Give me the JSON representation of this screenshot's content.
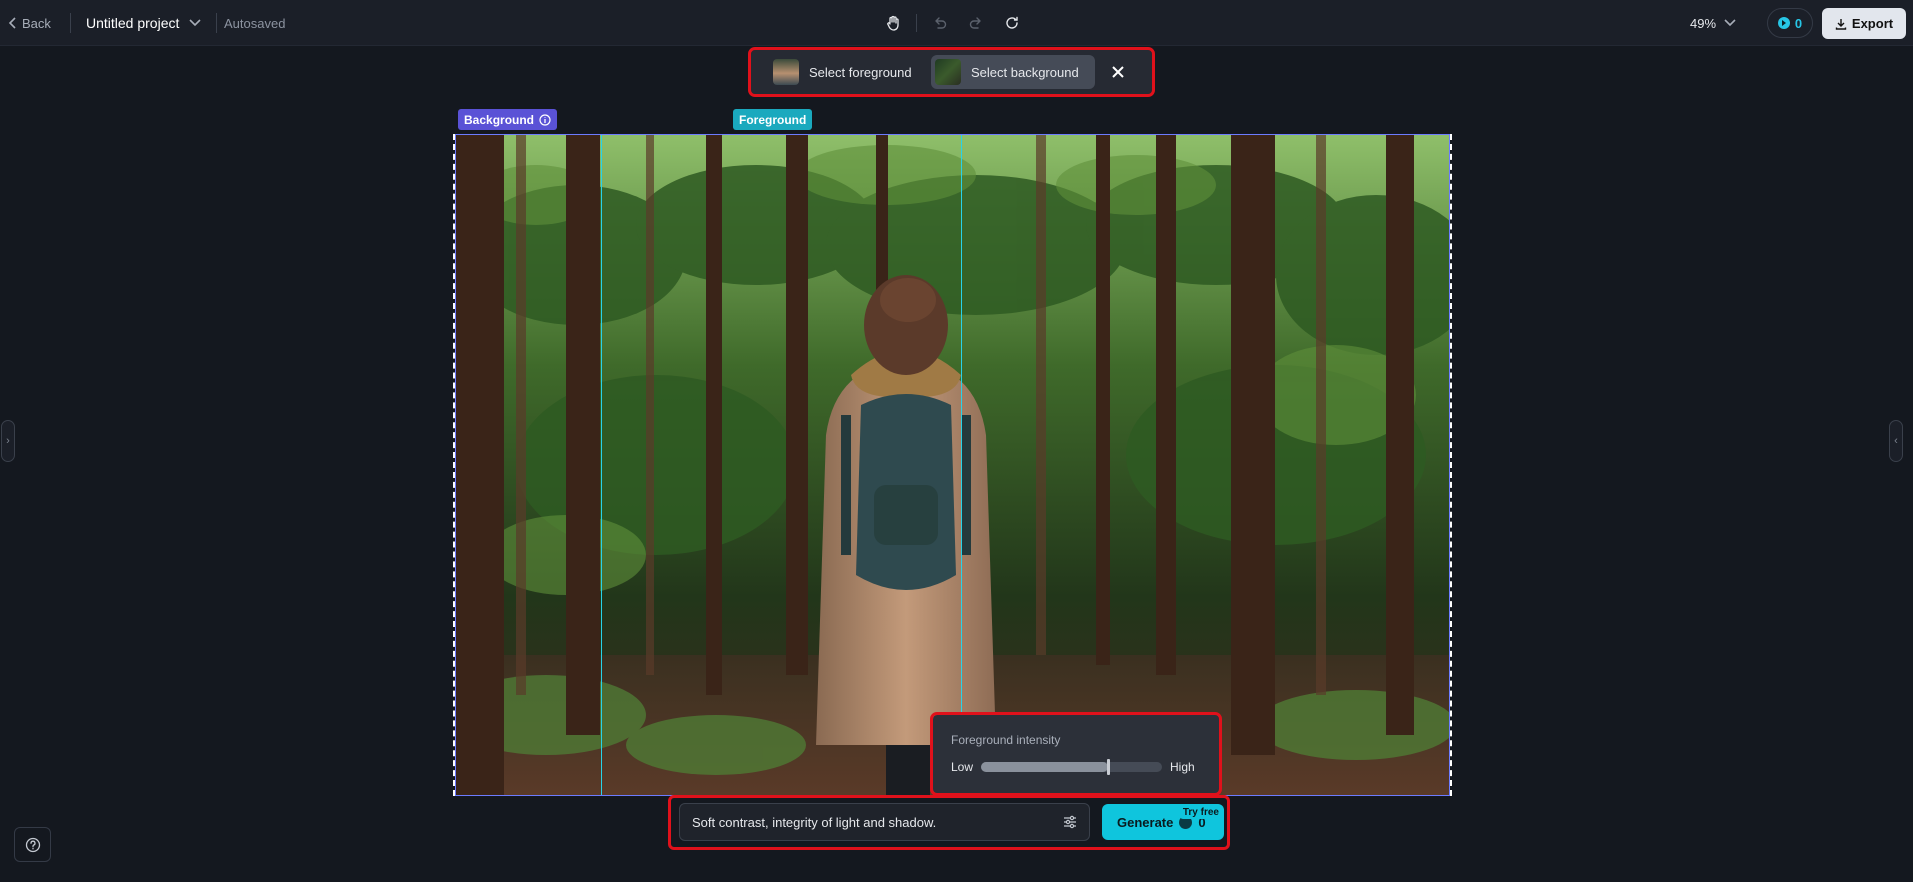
{
  "header": {
    "back_label": "Back",
    "project_name": "Untitled project",
    "autosave_status": "Autosaved",
    "zoom_level": "49%",
    "credits": "0",
    "export_label": "Export"
  },
  "tools": {
    "icons": [
      "hand-icon",
      "undo-icon",
      "redo-icon",
      "refresh-icon"
    ]
  },
  "select_bar": {
    "foreground_label": "Select foreground",
    "background_label": "Select background",
    "active": "background"
  },
  "canvas": {
    "background_tag": "Background",
    "foreground_tag": "Foreground"
  },
  "intensity": {
    "title": "Foreground intensity",
    "low_label": "Low",
    "high_label": "High",
    "value_fraction": 0.7
  },
  "prompt": {
    "text": "Soft contrast, integrity of light and shadow.",
    "generate_label": "Generate",
    "generate_cost": "0",
    "badge": "Try free"
  },
  "colors": {
    "accent": "#0fc5dd",
    "background_tag": "#5a52d6",
    "foreground_tag": "#1aa9be",
    "highlight": "#e0111b"
  }
}
